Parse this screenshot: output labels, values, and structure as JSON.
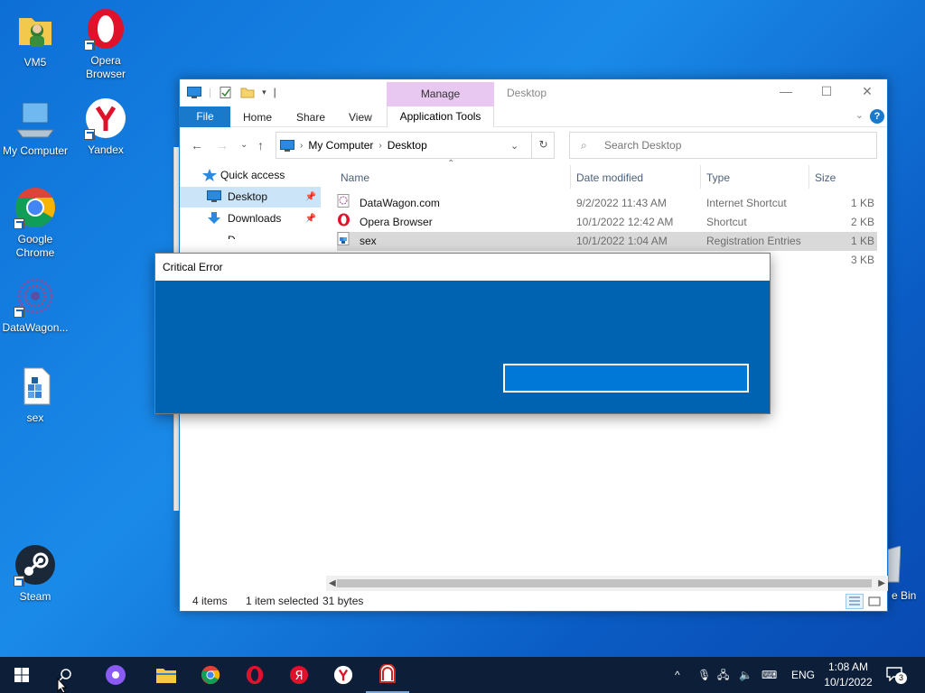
{
  "desktop": {
    "icons": [
      {
        "label": "VM5"
      },
      {
        "label": "Opera Browser"
      },
      {
        "label": "My Computer"
      },
      {
        "label": "Yandex"
      },
      {
        "label": "Google Chrome"
      },
      {
        "label": "DataWagon..."
      },
      {
        "label": "sex"
      },
      {
        "label": "Steam"
      }
    ],
    "recycle_partial_label": "e Bin"
  },
  "explorer": {
    "title": "Desktop",
    "manage_tab": "Manage",
    "ribbon_tabs": {
      "file": "File",
      "home": "Home",
      "share": "Share",
      "view": "View",
      "app_tools": "Application Tools"
    },
    "address": {
      "root": "My Computer",
      "current": "Desktop"
    },
    "search_placeholder": "Search Desktop",
    "nav": {
      "quick_access": "Quick access",
      "desktop": "Desktop",
      "downloads": "Downloads",
      "partial": "D"
    },
    "columns": {
      "name": "Name",
      "date": "Date modified",
      "type": "Type",
      "size": "Size"
    },
    "files": [
      {
        "name": "DataWagon.com",
        "date": "9/2/2022 11:43 AM",
        "type": "Internet Shortcut",
        "size": "1 KB"
      },
      {
        "name": "Opera Browser",
        "date": "10/1/2022 12:42 AM",
        "type": "Shortcut",
        "size": "2 KB"
      },
      {
        "name": "sex",
        "date": "10/1/2022 1:04 AM",
        "type": "Registration Entries",
        "size": "1 KB"
      },
      {
        "name": "",
        "date": "",
        "type": "",
        "size": "3 KB"
      }
    ],
    "status": {
      "items": "4 items",
      "selected": "1 item selected",
      "bytes": "31 bytes"
    }
  },
  "dialog": {
    "title": "Critical Error"
  },
  "taskbar": {
    "tray": {
      "lang": "ENG",
      "time": "1:08 AM",
      "date": "10/1/2022",
      "notifications": "3"
    }
  },
  "colors": {
    "accent": "#1979ca",
    "dialog_body": "#0063b1",
    "dialog_button": "#0078d7",
    "manage_tab": "#e8c7f1",
    "taskbar": "#0d1f38"
  }
}
